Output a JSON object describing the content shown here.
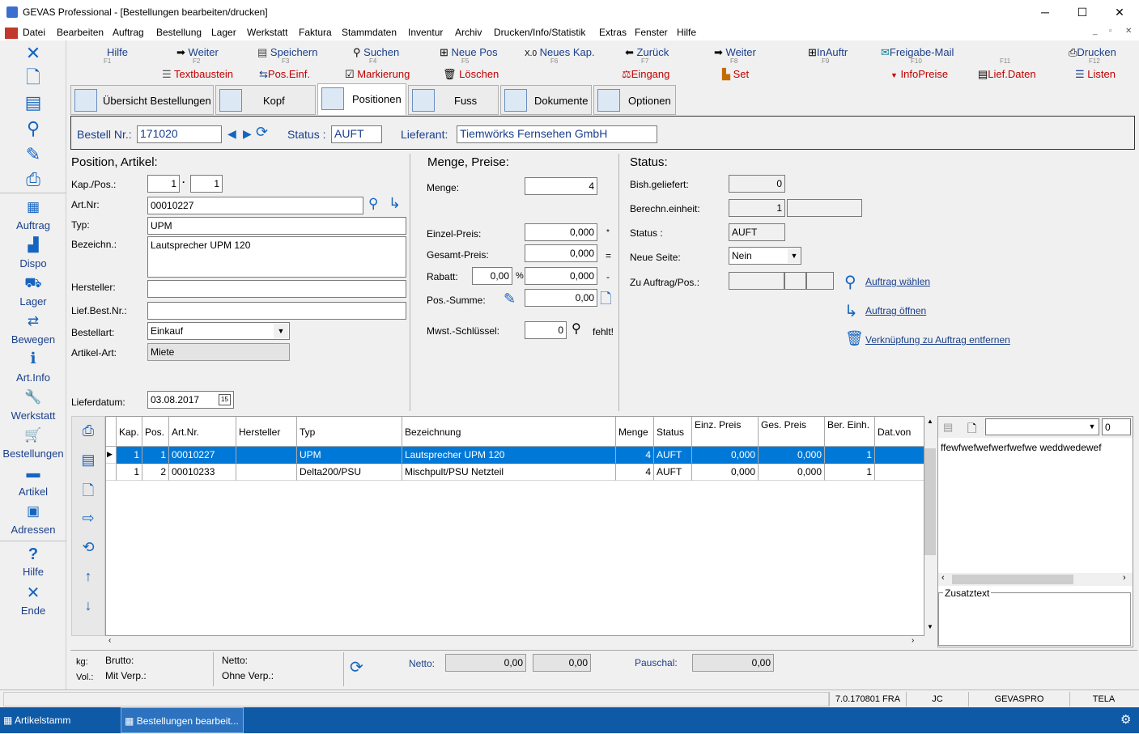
{
  "window": {
    "title": "GEVAS Professional - [Bestellungen bearbeiten/drucken]"
  },
  "menu": [
    "Datei",
    "Bearbeiten",
    "Auftrag",
    "Bestellung",
    "Lager",
    "Werkstatt",
    "Faktura",
    "Stammdaten",
    "Inventur",
    "Archiv",
    "Drucken/Info/Statistik",
    "Extras",
    "Fenster",
    "Hilfe"
  ],
  "sidebar": {
    "items": [
      "Auftrag",
      "Dispo",
      "Lager",
      "Bewegen",
      "Art.Info",
      "Werkstatt",
      "Bestellungen",
      "Artikel",
      "Adressen",
      "Hilfe",
      "Ende"
    ]
  },
  "toolbar": {
    "row1": [
      {
        "label": "Hilfe",
        "key": "F1"
      },
      {
        "label": "Weiter",
        "key": "F2"
      },
      {
        "label": "Speichern",
        "key": "F3"
      },
      {
        "label": "Suchen",
        "key": "F4"
      },
      {
        "label": "Neue Pos",
        "key": "F5"
      },
      {
        "label": "Neues Kap.",
        "key": "F6"
      },
      {
        "label": "Zurück",
        "key": "F7"
      },
      {
        "label": "Weiter",
        "key": "F8"
      },
      {
        "label": "InAuftr",
        "key": "F9"
      },
      {
        "label": "Freigabe-Mail",
        "key": "F10"
      },
      {
        "label": "Drucken",
        "key": "F12"
      }
    ],
    "row2": [
      "Textbaustein",
      "Pos.Einf.",
      "Markierung",
      "Löschen",
      "Eingang",
      "Set",
      "InfoPreise",
      "Lief.Daten",
      "Listen"
    ],
    "f11": "F11"
  },
  "tabs": [
    "Übersicht Bestellungen",
    "Kopf",
    "Positionen",
    "Fuss",
    "Dokumente",
    "Optionen"
  ],
  "header": {
    "bestell_label": "Bestell Nr.:",
    "bestell_nr": "171020",
    "status_label": "Status :",
    "status": "AUFT",
    "lieferant_label": "Lieferant:",
    "lieferant": "Tiemwörks Fernsehen GmbH"
  },
  "position": {
    "title": "Position, Artikel:",
    "kap_label": "Kap./Pos.:",
    "kap": "1",
    "pos": "1",
    "artnr_label": "Art.Nr:",
    "artnr": "00010227",
    "typ_label": "Typ:",
    "typ": "UPM",
    "bezeichn_label": "Bezeichn.:",
    "bezeichn": "Lautsprecher UPM 120",
    "hersteller_label": "Hersteller:",
    "hersteller": "",
    "liefbest_label": "Lief.Best.Nr.:",
    "liefbest": "",
    "bestellart_label": "Bestellart:",
    "bestellart": "Einkauf",
    "artikelart_label": "Artikel-Art:",
    "artikelart": "Miete",
    "lieferdatum_label": "Lieferdatum:",
    "lieferdatum": "03.08.2017"
  },
  "menge": {
    "title": "Menge, Preise:",
    "menge_label": "Menge:",
    "menge": "4",
    "einzel_label": "Einzel-Preis:",
    "einzel": "0,000",
    "gesamt_label": "Gesamt-Preis:",
    "gesamt": "0,000",
    "rabatt_label": "Rabatt:",
    "rabatt_pct": "0,00",
    "rabatt": "0,000",
    "possumme_label": "Pos.-Summe:",
    "possumme": "0,00",
    "mwst_label": "Mwst.-Schlüssel:",
    "mwst": "0",
    "fehlt": "fehlt!",
    "sym_star": "*",
    "sym_eq": "=",
    "sym_minus": "-",
    "sym_pct": "%"
  },
  "status": {
    "title": "Status:",
    "bish_label": "Bish.geliefert:",
    "bish": "0",
    "berechn_label": "Berechn.einheit:",
    "berechn": "1",
    "status_label": "Status :",
    "status": "AUFT",
    "neueseite_label": "Neue Seite:",
    "neueseite": "Nein",
    "zuauftrag_label": "Zu Auftrag/Pos.:",
    "link1": "Auftrag wählen",
    "link2": "Auftrag öffnen",
    "link3": "Verknüpfung zu Auftrag entfernen"
  },
  "grid": {
    "columns": [
      "Kap.",
      "Pos.",
      "Art.Nr.",
      "Hersteller",
      "Typ",
      "Bezeichnung",
      "Menge",
      "Status",
      "Einz. Preis",
      "Ges. Preis",
      "Ber. Einh.",
      "Dat.von"
    ],
    "rows": [
      [
        "1",
        "1",
        "00010227",
        "",
        "UPM",
        "Lautsprecher UPM 120",
        "4",
        "AUFT",
        "0,000",
        "0,000",
        "1",
        ""
      ],
      [
        "1",
        "2",
        "00010233",
        "",
        "Delta200/PSU",
        "Mischpult/PSU Netzteil",
        "4",
        "AUFT",
        "0,000",
        "0,000",
        "1",
        ""
      ]
    ]
  },
  "notes": {
    "text": "ffewfwefwefwerfwefwe weddwedewef",
    "num": "0",
    "zusatz": "Zusatztext"
  },
  "footer": {
    "kg": "kg:",
    "vol": "Vol.:",
    "brutto": "Brutto:",
    "mitverp": "Mit Verp.:",
    "netto_l": "Netto:",
    "ohneverp": "Ohne Verp.:",
    "netto_label": "Netto:",
    "netto1": "0,00",
    "netto2": "0,00",
    "pauschal_label": "Pauschal:",
    "pauschal": "0,00"
  },
  "statusbar": {
    "version": "7.0.170801 FRA",
    "user": "JC",
    "db": "GEVASPRO",
    "tela": "TELA"
  },
  "taskbar": {
    "t1": "Artikelstamm",
    "t2": "Bestellungen bearbeit..."
  }
}
